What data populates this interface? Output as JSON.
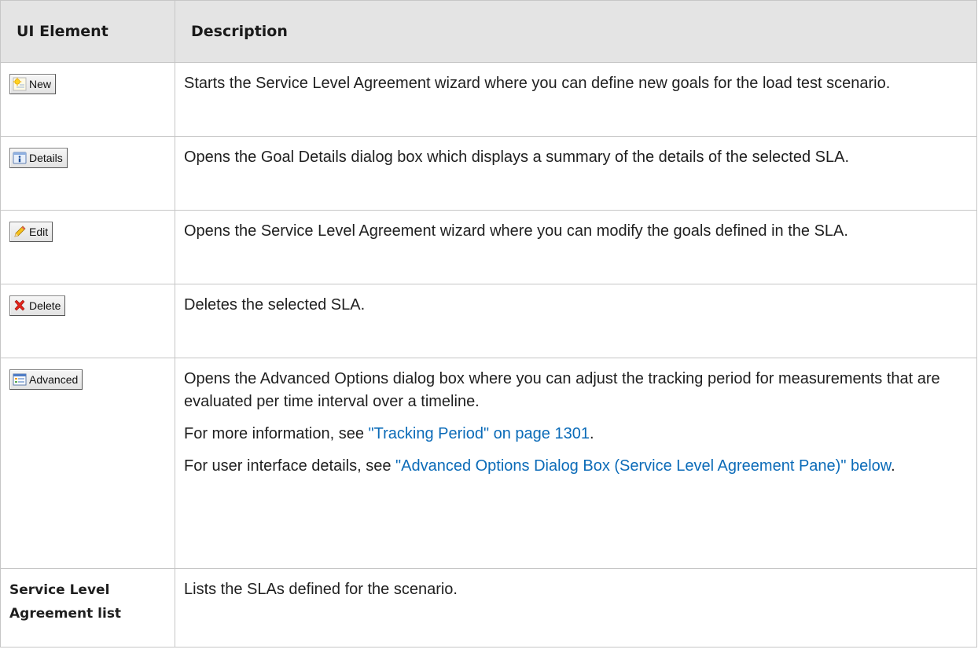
{
  "header": {
    "col1": "UI Element",
    "col2": "Description"
  },
  "rows": [
    {
      "button": "New",
      "icon": "sun-new-icon",
      "desc": "Starts the Service Level Agreement wizard where you can define new goals for the load test scenario."
    },
    {
      "button": "Details",
      "icon": "info-details-icon",
      "desc": "Opens the Goal Details dialog box which displays a summary of the details of the selected SLA."
    },
    {
      "button": "Edit",
      "icon": "pencil-edit-icon",
      "desc": "Opens the Service Level Agreement wizard where you can modify the goals defined in the SLA."
    },
    {
      "button": "Delete",
      "icon": "red-x-delete-icon",
      "desc": "Deletes the selected SLA."
    },
    {
      "button": "Advanced",
      "icon": "advanced-options-icon",
      "desc": "Opens the Advanced Options dialog box where you can adjust the tracking period for measurements that are evaluated per time interval over a timeline.",
      "more_prefix": "For more information, see ",
      "more_link": "\"Tracking Period\" on page 1301",
      "more_suffix": ".",
      "ui_prefix": "For user interface details, see ",
      "ui_link": "\"Advanced Options Dialog Box (Service Level Agreement Pane)\" below",
      "ui_suffix": "."
    },
    {
      "label": "Service Level Agreement list",
      "desc": "Lists the SLAs defined for the scenario."
    }
  ],
  "colors": {
    "link": "#0b6bb8",
    "header_bg": "#e4e4e4",
    "border": "#c6c6c6"
  }
}
